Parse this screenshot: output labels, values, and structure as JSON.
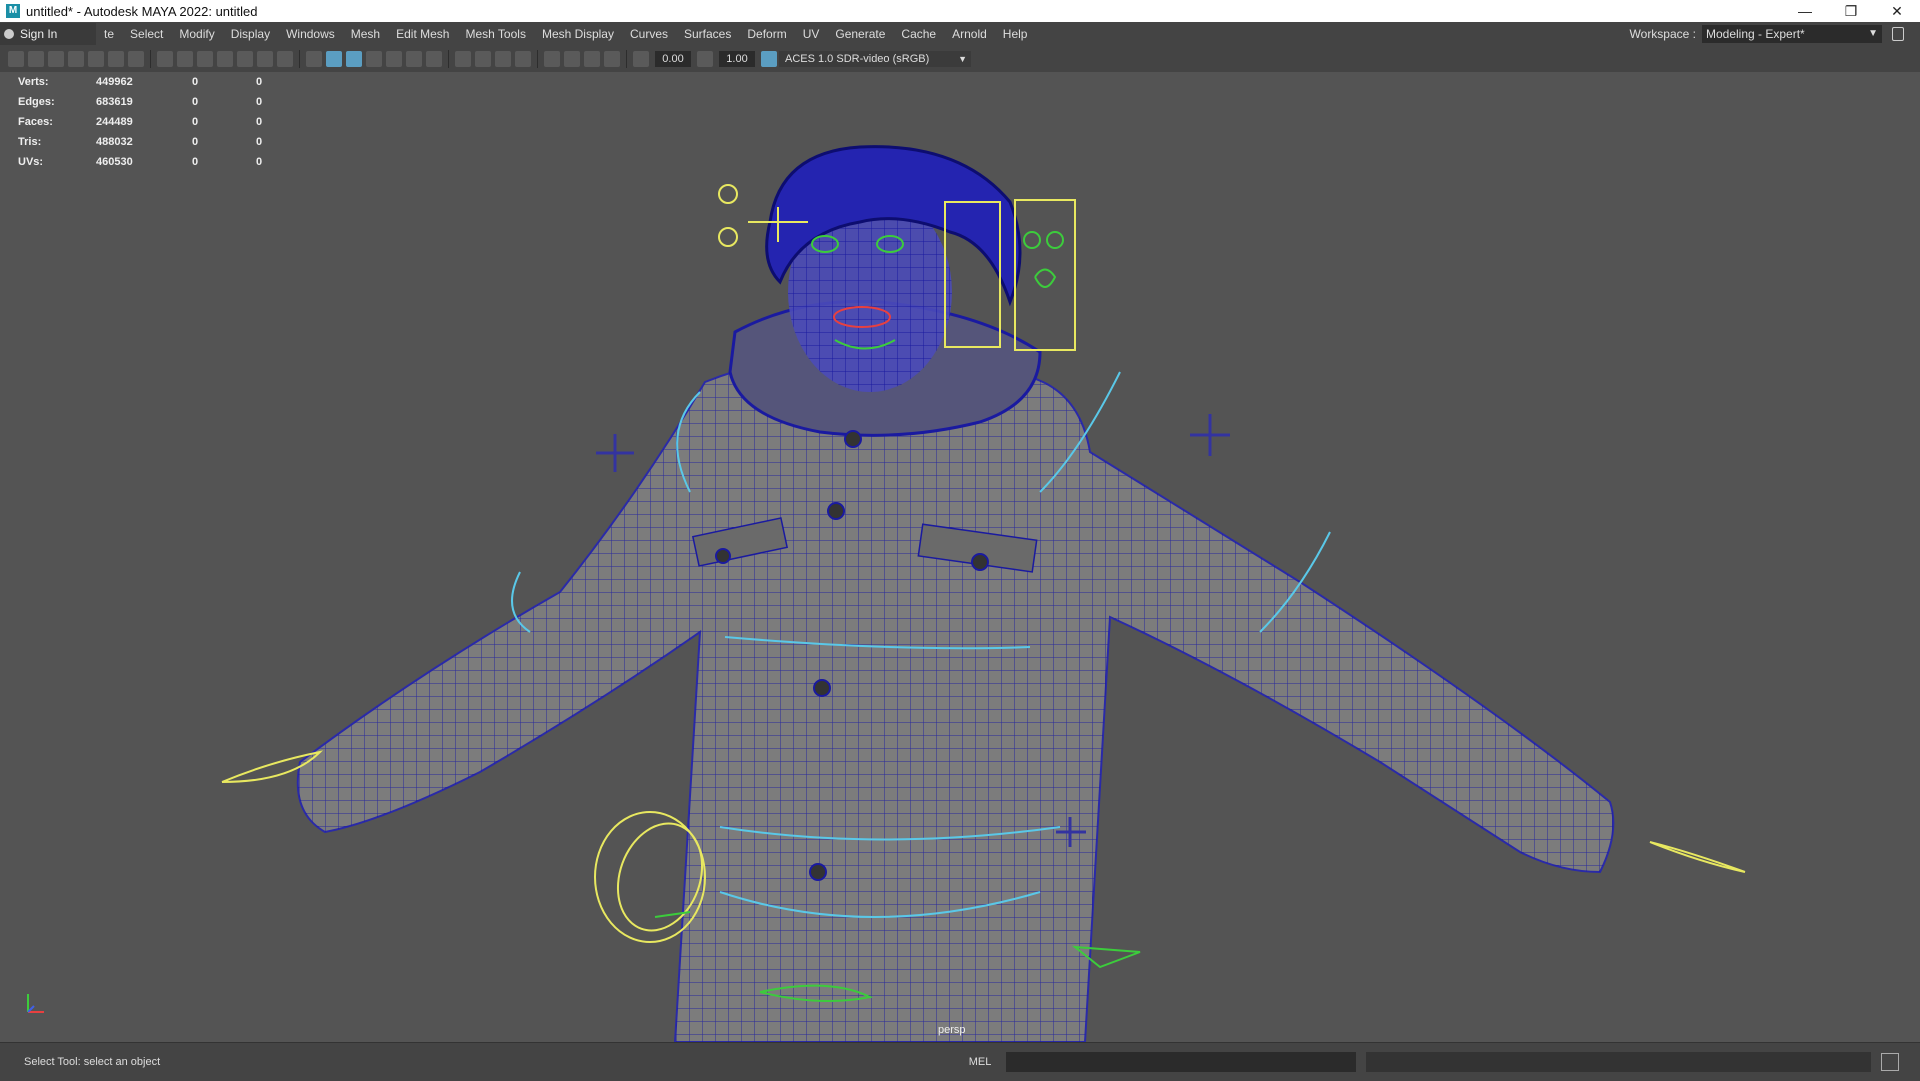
{
  "window": {
    "title": "untitled* - Autodesk MAYA 2022: untitled",
    "logo": "M"
  },
  "menubar": {
    "signin_label": "Sign In",
    "items": [
      "te",
      "Select",
      "Modify",
      "Display",
      "Windows",
      "Mesh",
      "Edit Mesh",
      "Mesh Tools",
      "Mesh Display",
      "Curves",
      "Surfaces",
      "Deform",
      "UV",
      "Generate",
      "Cache",
      "Arnold",
      "Help"
    ],
    "workspace_label": "Workspace :",
    "workspace_value": "Modeling - Expert*"
  },
  "toolbar": {
    "exposure_value": "0.00",
    "gamma_value": "1.00",
    "colorspace": "ACES 1.0 SDR-video (sRGB)"
  },
  "hud": {
    "rows": [
      {
        "label": "Verts:",
        "value": "449962",
        "a": "0",
        "b": "0"
      },
      {
        "label": "Edges:",
        "value": "683619",
        "a": "0",
        "b": "0"
      },
      {
        "label": "Faces:",
        "value": "244489",
        "a": "0",
        "b": "0"
      },
      {
        "label": "Tris:",
        "value": "488032",
        "a": "0",
        "b": "0"
      },
      {
        "label": "UVs:",
        "value": "460530",
        "a": "0",
        "b": "0"
      }
    ]
  },
  "viewport": {
    "camera": "persp"
  },
  "statusbar": {
    "message": "Select Tool: select an object",
    "mel_label": "MEL"
  },
  "colors": {
    "viewport_bg": "#545454",
    "wire_blue": "#1a1aa0",
    "ctrl_cyan": "#5ac8e8",
    "ctrl_yellow": "#e8e860",
    "ctrl_green": "#3ccc3c"
  }
}
